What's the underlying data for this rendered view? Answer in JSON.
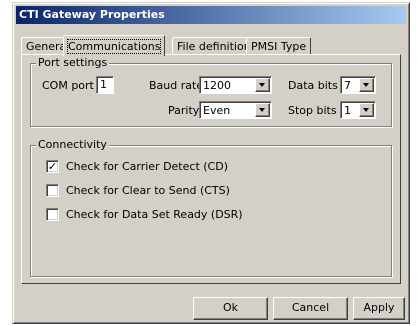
{
  "window": {
    "title": "CTI Gateway Properties"
  },
  "tabs": [
    {
      "label": "General"
    },
    {
      "label": "Communications"
    },
    {
      "label": "File definitions"
    },
    {
      "label": "PMSI Type"
    }
  ],
  "active_tab": "Communications",
  "port_settings": {
    "group_label": "Port settings",
    "com_port": {
      "label": "COM port",
      "value": "1"
    },
    "baud_rate": {
      "label": "Baud rate",
      "value": "1200"
    },
    "data_bits": {
      "label": "Data bits",
      "value": "7"
    },
    "parity": {
      "label": "Parity",
      "value": "Even"
    },
    "stop_bits": {
      "label": "Stop bits",
      "value": "1"
    }
  },
  "connectivity": {
    "group_label": "Connectivity",
    "options": [
      {
        "label": "Check for Carrier Detect (CD)",
        "checked": true
      },
      {
        "label": "Check for Clear to Send (CTS)",
        "checked": false
      },
      {
        "label": "Check for Data Set Ready (DSR)",
        "checked": false
      }
    ]
  },
  "buttons": {
    "ok": "Ok",
    "cancel": "Cancel",
    "apply": "Apply"
  },
  "colors": {
    "face": "#d4d0c8",
    "title_start": "#0a246a",
    "title_end": "#a6caf0"
  }
}
